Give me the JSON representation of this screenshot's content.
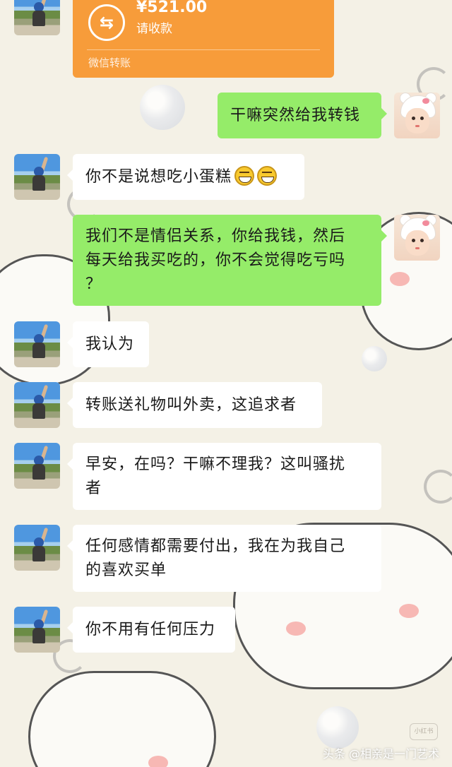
{
  "transfer": {
    "icon": "transfer-arrows-icon",
    "icon_glyph": "⇆",
    "amount": "¥521.00",
    "status": "请收款",
    "footer": "微信转账"
  },
  "messages": [
    {
      "side": "right",
      "lines": [
        "干嘛突然给我转钱"
      ]
    },
    {
      "side": "left",
      "lines": [
        "你不是说想吃小蛋糕"
      ],
      "emojis": [
        "grin-emoji",
        "grin-emoji"
      ]
    },
    {
      "side": "right",
      "lines": [
        "我们不是情侣关系，你给我钱，然后",
        "每天给我买吃的，你不会觉得吃亏吗",
        "？"
      ]
    },
    {
      "side": "left",
      "lines": [
        "我认为"
      ]
    },
    {
      "side": "left",
      "lines": [
        "转账送礼物叫外卖，这追求者"
      ]
    },
    {
      "side": "left",
      "lines": [
        "早安，在吗？干嘛不理我？这叫骚扰",
        "者"
      ]
    },
    {
      "side": "left",
      "lines": [
        "任何感情都需要付出，我在为我自己",
        "的喜欢买单"
      ]
    },
    {
      "side": "left",
      "lines": [
        "你不用有任何压力"
      ]
    }
  ],
  "watermark": "头条 @相亲是一门艺术",
  "badge": "小红书",
  "colors": {
    "green_bubble": "#95ec69",
    "white_bubble": "#ffffff",
    "transfer_orange": "#f79c3a",
    "background": "#f4f1e6"
  }
}
